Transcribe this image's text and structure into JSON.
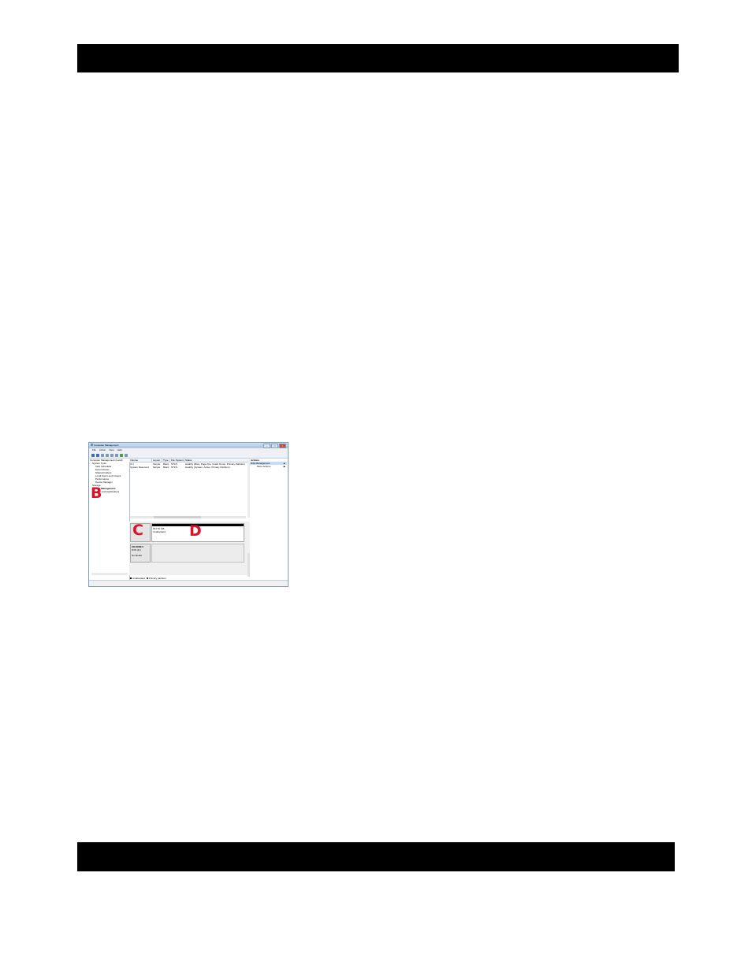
{
  "window": {
    "title": "Computer Management",
    "menu": [
      "File",
      "Action",
      "View",
      "Help"
    ]
  },
  "tree": {
    "items": [
      "Computer Management (Local)",
      "System Tools",
      "Task Scheduler",
      "Event Viewer",
      "Shared Folders",
      "Local Users and Groups",
      "Performance",
      "Device Manager",
      "Storage",
      "Disk Management",
      "Services and Applications"
    ]
  },
  "volumes": {
    "columns": [
      "Volume",
      "Layout",
      "Type",
      "File System",
      "Status"
    ],
    "rows": [
      [
        "(C:)",
        "Simple",
        "Basic",
        "NTFS",
        "Healthy (Boot, Page File, Crash Dump, Primary Partition)"
      ],
      [
        "System Reserved",
        "Simple",
        "Basic",
        "NTFS",
        "Healthy (System, Active, Primary Partition)"
      ]
    ]
  },
  "disks": {
    "disk0_size": "931.51 GB",
    "disk0_status": "Unallocated",
    "cdrom_label": "CD-ROM 0",
    "cdrom_type": "DVD (E:)",
    "cdrom_media": "No Media"
  },
  "legend": {
    "unallocated": "Unallocated",
    "primary": "Primary partition"
  },
  "actions": {
    "header": "Actions",
    "selected": "Disk Management",
    "more": "More Actions"
  },
  "callouts": {
    "b": "B",
    "c": "C",
    "d": "D"
  }
}
